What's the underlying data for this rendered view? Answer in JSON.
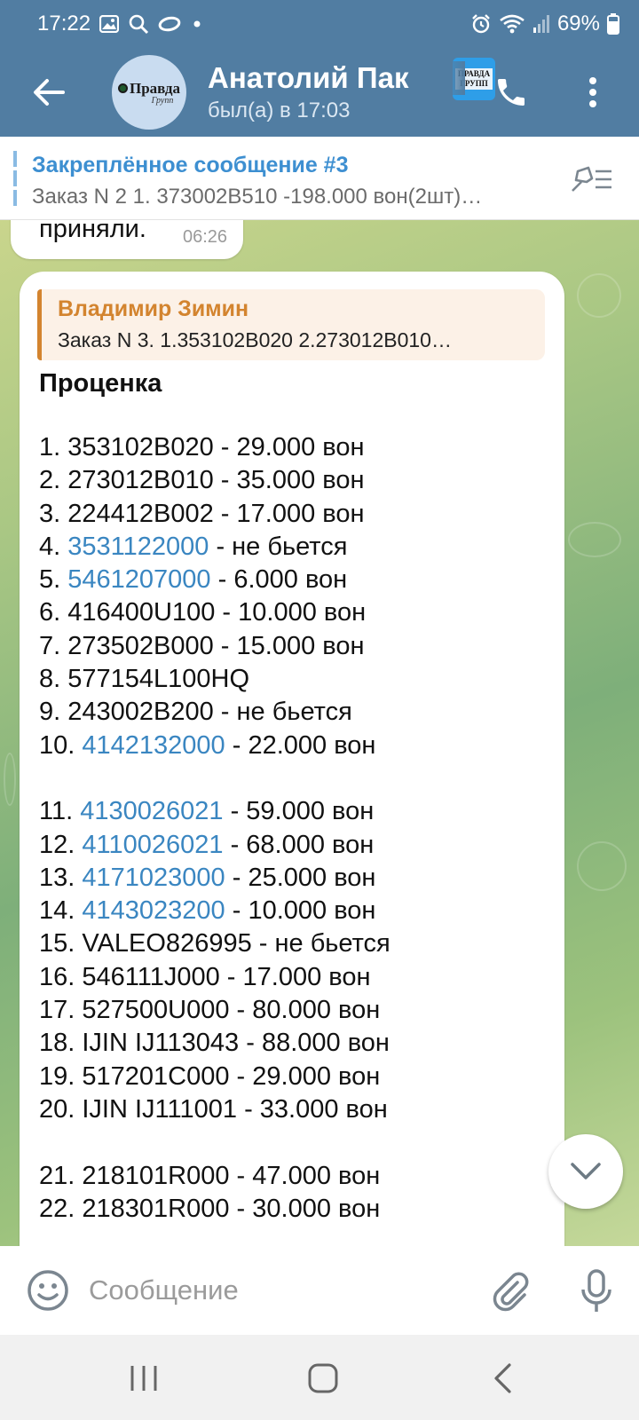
{
  "status_bar": {
    "time": "17:22",
    "battery": "69%",
    "left_icons": [
      "gallery-icon",
      "search-icon",
      "link-icon",
      "dot-icon"
    ],
    "right_icons": [
      "alarm-icon",
      "wifi-icon",
      "signal-icon",
      "battery-icon"
    ]
  },
  "header": {
    "title": "Анатолий Пак",
    "status": "был(а) в 17:03",
    "avatar_text": "Правда",
    "avatar_sub": "Групп",
    "badge_text": "ПРАВДА ГРУПП"
  },
  "pinned": {
    "title": "Закреплённое сообщение #3",
    "text": "Заказ N 2  1. 373002B510 -198.000 вон(2шт)…"
  },
  "previous_message": {
    "text": "приняли.",
    "time": "06:26"
  },
  "message": {
    "reply_name": "Владимир Зимин",
    "reply_text": "Заказ N 3. 1.353102B020 2.273012B010…",
    "heading": "Проценка",
    "lines": [
      {
        "num": "1. ",
        "code": "353102B020",
        "link": false,
        "rest": " - 29.000 вон"
      },
      {
        "num": "2. ",
        "code": "273012B010",
        "link": false,
        "rest": " - 35.000 вон"
      },
      {
        "num": "3. ",
        "code": "224412B002",
        "link": false,
        "rest": " - 17.000 вон"
      },
      {
        "num": "4. ",
        "code": "3531122000",
        "link": true,
        "rest": " - не бьется"
      },
      {
        "num": "5. ",
        "code": "5461207000",
        "link": true,
        "rest": " - 6.000 вон"
      },
      {
        "num": "6. ",
        "code": "416400U100",
        "link": false,
        "rest": " - 10.000 вон"
      },
      {
        "num": "7. ",
        "code": "273502B000",
        "link": false,
        "rest": " - 15.000 вон"
      },
      {
        "num": "8. ",
        "code": "577154L100HQ",
        "link": false,
        "rest": ""
      },
      {
        "num": "9. ",
        "code": "243002B200",
        "link": false,
        "rest": " - не бьется"
      },
      {
        "num": "10. ",
        "code": "4142132000",
        "link": true,
        "rest": " - 22.000 вон"
      },
      {
        "blank": true
      },
      {
        "num": "11. ",
        "code": "4130026021",
        "link": true,
        "rest": " - 59.000 вон"
      },
      {
        "num": "12. ",
        "code": "4110026021",
        "link": true,
        "rest": " - 68.000 вон"
      },
      {
        "num": "13. ",
        "code": "4171023000",
        "link": true,
        "rest": " - 25.000 вон"
      },
      {
        "num": "14. ",
        "code": "4143023200",
        "link": true,
        "rest": " - 10.000 вон"
      },
      {
        "num": "15. ",
        "code": "VALEO826995",
        "link": false,
        "rest": " - не бьется"
      },
      {
        "num": "16. ",
        "code": "546111J000",
        "link": false,
        "rest": " - 17.000 вон"
      },
      {
        "num": "17. ",
        "code": "527500U000",
        "link": false,
        "rest": " - 80.000 вон"
      },
      {
        "num": "18. ",
        "code": "IJIN IJ113043",
        "link": false,
        "rest": " - 88.000 вон"
      },
      {
        "num": "19. ",
        "code": "517201C000",
        "link": false,
        "rest": " - 29.000 вон"
      },
      {
        "num": "20. ",
        "code": "IJIN IJ111001",
        "link": false,
        "rest": " - 33.000 вон"
      },
      {
        "blank": true
      },
      {
        "num": "21. ",
        "code": "218101R000",
        "link": false,
        "rest": " - 47.000 вон"
      },
      {
        "num": "22. ",
        "code": "218301R000",
        "link": false,
        "rest": " - 30.000 вон"
      }
    ]
  },
  "input": {
    "placeholder": "Сообщение",
    "value": ""
  },
  "colors": {
    "header_bg": "#517da2",
    "link": "#3a86c1",
    "reply_accent": "#d3842f",
    "pinned_title": "#3d8fd1"
  }
}
